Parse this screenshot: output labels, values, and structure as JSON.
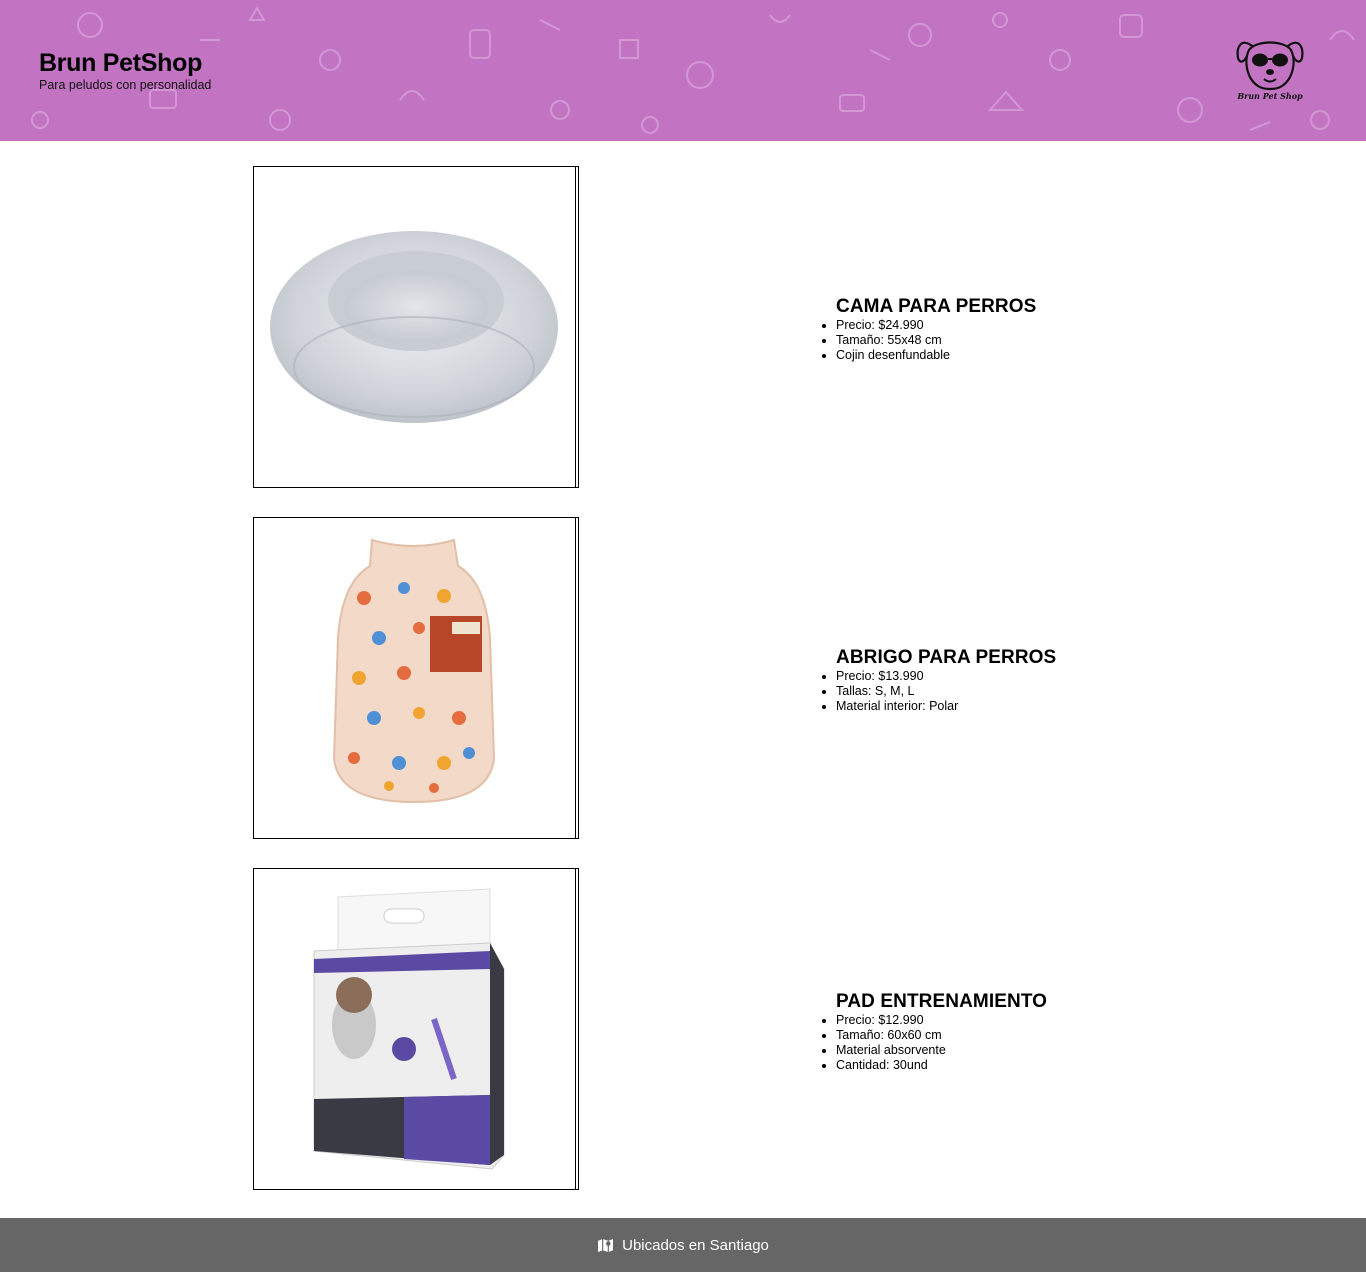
{
  "header": {
    "title": "Brun PetShop",
    "subtitle": "Para peludos con personalidad",
    "logo_text": "Brun Pet Shop",
    "logo_icon": "dog-with-sunglasses-icon",
    "background_color": "#c274c3"
  },
  "products": [
    {
      "name": "CAMA PARA PERROS",
      "image": "dog-bed-image",
      "details": [
        "Precio: $24.990",
        "Tamaño: 55x48 cm",
        "Cojin desenfundable"
      ]
    },
    {
      "name": "ABRIGO PARA PERROS",
      "image": "dog-coat-image",
      "details": [
        "Precio: $13.990",
        "Tallas: S, M, L",
        "Material interior: Polar"
      ]
    },
    {
      "name": "PAD ENTRENAMIENTO",
      "image": "training-pads-image",
      "details": [
        "Precio: $12.990",
        "Tamaño: 60x60 cm",
        "Material absorvente",
        "Cantidad: 30und"
      ]
    }
  ],
  "footer": {
    "icon": "map-icon",
    "location": "Ubicados en Santiago",
    "background_color": "#666666"
  }
}
